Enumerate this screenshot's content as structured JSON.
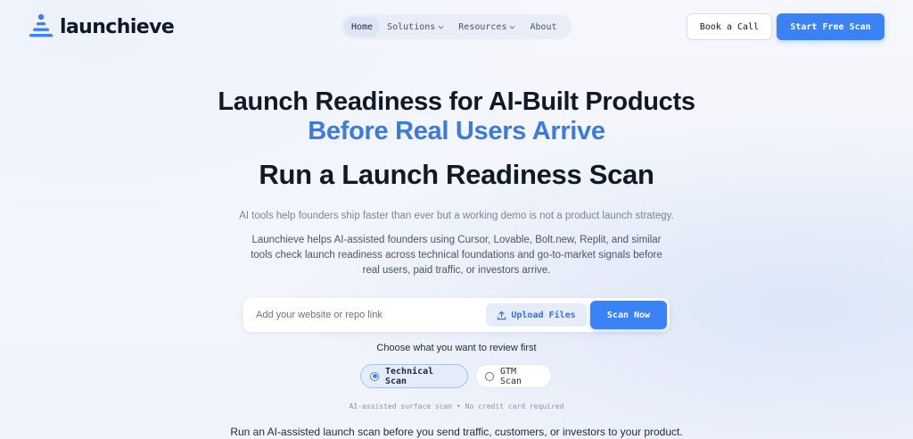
{
  "header": {
    "logo_text": "launchieve",
    "nav": [
      {
        "label": "Home"
      },
      {
        "label": "Solutions"
      },
      {
        "label": "Resources"
      },
      {
        "label": "About"
      }
    ],
    "book_call_label": "Book a Call",
    "start_scan_label": "Start Free Scan"
  },
  "hero": {
    "title_line1": "Launch Readiness for AI-Built Products",
    "title_line2": "Before Real Users Arrive",
    "subtitle": "Run a Launch Readiness Scan",
    "para1": "AI tools help founders ship faster than ever but a working demo is not a product launch strategy.",
    "para2": "Launchieve helps AI-assisted founders using Cursor, Lovable, Bolt.new, Replit, and similar tools check launch readiness across technical foundations and go-to-market signals before real users, paid traffic, or investors arrive."
  },
  "scan": {
    "placeholder": "Add your website or repo link",
    "upload_label": "Upload Files",
    "scan_label": "Scan Now",
    "choose_label": "Choose what you want to review first",
    "options": [
      {
        "label": "Technical Scan",
        "selected": true
      },
      {
        "label": "GTM Scan",
        "selected": false
      }
    ],
    "note": "AI-assisted surface scan • No credit card required"
  },
  "bottom_text": "Run an AI-assisted launch scan before you send traffic, customers, or investors to your product.",
  "colors": {
    "accent": "#3b82f6",
    "accent_text": "#3b7ae0"
  }
}
